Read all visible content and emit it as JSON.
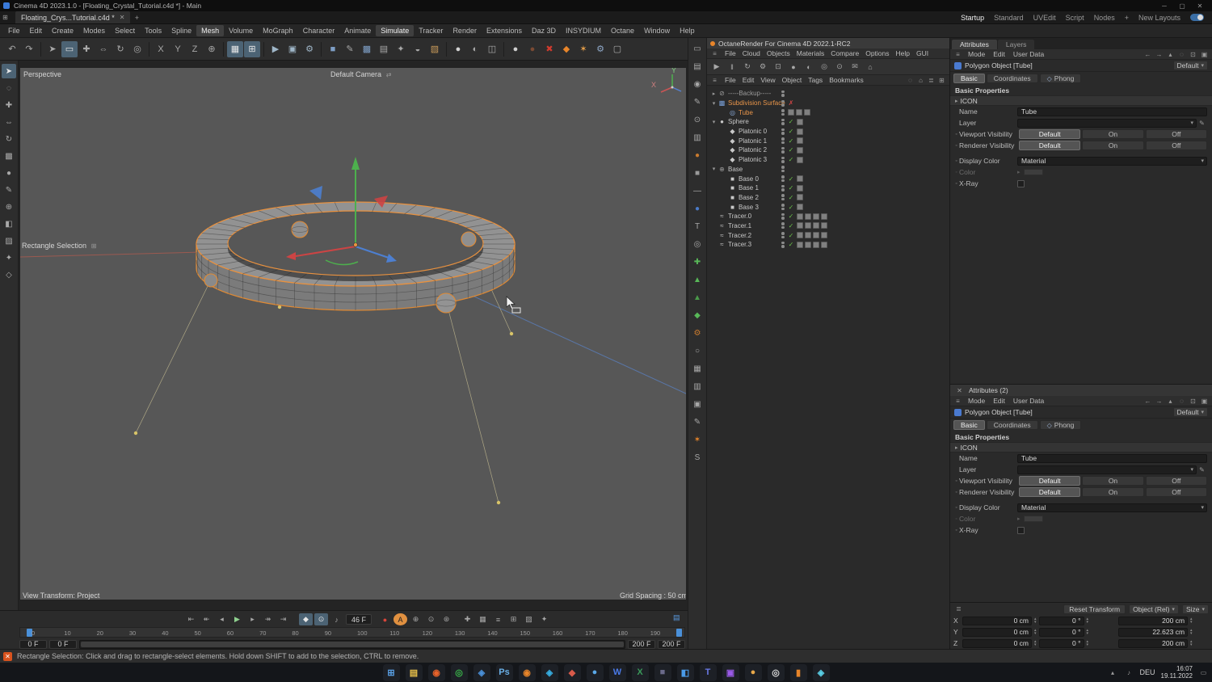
{
  "window": {
    "title": "Cinema 4D 2023.1.0 - [Floating_Crystal_Tutorial.c4d *] - Main",
    "min": "─",
    "max": "▢",
    "close": "✕"
  },
  "tabbar": {
    "doc_tab": "Floating_Crys...Tutorial.c4d *",
    "close_glyph": "✕",
    "add_glyph": "+",
    "layouts": [
      "Startup",
      "Standard",
      "UVEdit",
      "Script",
      "Nodes"
    ],
    "active_layout_index": 0,
    "add_layout_glyph": "+",
    "new_layouts_label": "New Layouts"
  },
  "menubar": {
    "items": [
      "File",
      "Edit",
      "Create",
      "Modes",
      "Select",
      "Tools",
      "Spline",
      "Mesh",
      "Volume",
      "MoGraph",
      "Character",
      "Animate",
      "Simulate",
      "Tracker",
      "Render",
      "Extensions",
      "Daz 3D",
      "INSYDIUM",
      "Octane",
      "Window",
      "Help"
    ],
    "highlighted": [
      "Mesh",
      "Simulate"
    ]
  },
  "viewport": {
    "view_label": "Perspective",
    "camera_label": "Default Camera",
    "selection_tool_label": "Rectangle Selection",
    "transform_label": "View Transform: Project",
    "grid_label": "Grid Spacing : 50 cm",
    "axis_labels": {
      "x": "X",
      "y": "Y"
    }
  },
  "timeline": {
    "frame_field": "46 F",
    "ticks": [
      "0",
      "10",
      "20",
      "30",
      "40",
      "50",
      "60",
      "70",
      "80",
      "90",
      "100",
      "110",
      "120",
      "130",
      "140",
      "150",
      "160",
      "170",
      "180",
      "190"
    ],
    "range_fields": [
      "0 F",
      "0 F",
      "200 F",
      "200 F"
    ]
  },
  "status_bar": {
    "text": "Rectangle Selection: Click and drag to rectangle-select elements. Hold down SHIFT to add to the selection, CTRL to remove."
  },
  "octane": {
    "title": "OctaneRender For Cinema 4D 2022.1-RC2",
    "menus": [
      "File",
      "Cloud",
      "Objects",
      "Materials",
      "Compare",
      "Options",
      "Help",
      "GUI"
    ]
  },
  "object_manager": {
    "menus": [
      "File",
      "Edit",
      "View",
      "Object",
      "Tags",
      "Bookmarks"
    ],
    "items": [
      {
        "label": "-----Backup-----",
        "indent": 0,
        "arrow": "closed",
        "icon_g": "⊘",
        "icon_c": "#9a9a9a",
        "label_c": "#9a9a9a",
        "dots": true,
        "mark": null,
        "tags": 0,
        "selected": false
      },
      {
        "label": "Subdivision Surface",
        "indent": 0,
        "arrow": "open",
        "icon_g": "▩",
        "icon_c": "#7aa0d8",
        "dots": true,
        "mark": "x",
        "tags": 0,
        "selected": true
      },
      {
        "label": "Tube",
        "indent": 1,
        "arrow": null,
        "icon_g": "◎",
        "icon_c": "#8fb0e0",
        "dots": true,
        "mark": null,
        "tags": 3,
        "selected": true
      },
      {
        "label": "Sphere",
        "indent": 0,
        "arrow": "open",
        "icon_g": "●",
        "icon_c": "#c8c8c8",
        "dots": true,
        "mark": "check",
        "tags": 1,
        "selected": false
      },
      {
        "label": "Platonic 0",
        "indent": 1,
        "arrow": null,
        "icon_g": "◆",
        "icon_c": "#c8c8c8",
        "dots": true,
        "mark": "check",
        "tags": 1,
        "selected": false
      },
      {
        "label": "Platonic 1",
        "indent": 1,
        "arrow": null,
        "icon_g": "◆",
        "icon_c": "#c8c8c8",
        "dots": true,
        "mark": "check",
        "tags": 1,
        "selected": false
      },
      {
        "label": "Platonic 2",
        "indent": 1,
        "arrow": null,
        "icon_g": "◆",
        "icon_c": "#c8c8c8",
        "dots": true,
        "mark": "check",
        "tags": 1,
        "selected": false
      },
      {
        "label": "Platonic 3",
        "indent": 1,
        "arrow": null,
        "icon_g": "◆",
        "icon_c": "#c8c8c8",
        "dots": true,
        "mark": "check",
        "tags": 1,
        "selected": false
      },
      {
        "label": "Base",
        "indent": 0,
        "arrow": "open",
        "icon_g": "⊕",
        "icon_c": "#9a9a9a",
        "dots": true,
        "mark": null,
        "tags": 0,
        "selected": false
      },
      {
        "label": "Base 0",
        "indent": 1,
        "arrow": null,
        "icon_g": "■",
        "icon_c": "#c8c8c8",
        "dots": true,
        "mark": "check",
        "tags": 1,
        "selected": false
      },
      {
        "label": "Base 1",
        "indent": 1,
        "arrow": null,
        "icon_g": "■",
        "icon_c": "#c8c8c8",
        "dots": true,
        "mark": "check",
        "tags": 1,
        "selected": false
      },
      {
        "label": "Base 2",
        "indent": 1,
        "arrow": null,
        "icon_g": "■",
        "icon_c": "#c8c8c8",
        "dots": true,
        "mark": "check",
        "tags": 1,
        "selected": false
      },
      {
        "label": "Base 3",
        "indent": 1,
        "arrow": null,
        "icon_g": "■",
        "icon_c": "#c8c8c8",
        "dots": true,
        "mark": "check",
        "tags": 1,
        "selected": false
      },
      {
        "label": "Tracer.0",
        "indent": 0,
        "arrow": null,
        "icon_g": "≈",
        "icon_c": "#c8c8c8",
        "dots": true,
        "mark": "check",
        "tags": 4,
        "selected": false
      },
      {
        "label": "Tracer.1",
        "indent": 0,
        "arrow": null,
        "icon_g": "≈",
        "icon_c": "#c8c8c8",
        "dots": true,
        "mark": "check",
        "tags": 4,
        "selected": false
      },
      {
        "label": "Tracer.2",
        "indent": 0,
        "arrow": null,
        "icon_g": "≈",
        "icon_c": "#c8c8c8",
        "dots": true,
        "mark": "check",
        "tags": 4,
        "selected": false
      },
      {
        "label": "Tracer.3",
        "indent": 0,
        "arrow": null,
        "icon_g": "≈",
        "icon_c": "#c8c8c8",
        "dots": true,
        "mark": "check",
        "tags": 4,
        "selected": false
      }
    ]
  },
  "attr_panels": {
    "panel1_tab_attributes": "Attributes",
    "panel1_tab_layers": "Layers",
    "panel2_title": "Attributes (2)",
    "panel2_close_glyph": "✕"
  },
  "attr": {
    "menus": [
      "Mode",
      "Edit",
      "User Data"
    ],
    "object_title": "Polygon Object [Tube]",
    "preset": "Default",
    "tabs": [
      "Basic",
      "Coordinates",
      "Phong"
    ],
    "section": "Basic Properties",
    "icon_group": "ICON",
    "name_label": "Name",
    "name_value": "Tube",
    "layer_label": "Layer",
    "viewport_visibility_label": "Viewport Visibility",
    "renderer_visibility_label": "Renderer Visibility",
    "visibility_options": [
      "Default",
      "On",
      "Off"
    ],
    "display_color_label": "Display Color",
    "display_color_value": "Material",
    "color_label": "Color",
    "xray_label": "X-Ray"
  },
  "coordinates": {
    "reset_label": "Reset Transform",
    "mode_label": "Object (Rel)",
    "size_label": "Size",
    "rows": [
      {
        "axis": "X",
        "pos": "0 cm",
        "rot": "0 °",
        "size": "200 cm"
      },
      {
        "axis": "Y",
        "pos": "0 cm",
        "rot": "0 °",
        "size": "22.623 cm"
      },
      {
        "axis": "Z",
        "pos": "0 cm",
        "rot": "0 °",
        "size": "200 cm"
      }
    ]
  },
  "taskbar": {
    "time": "16:07",
    "date": "19.11.2022",
    "lang": "DEU",
    "apps": [
      {
        "n": "start-button",
        "g": "⊞",
        "c": "#5aa2e8"
      },
      {
        "n": "taskbar-explorer",
        "g": "▤",
        "c": "#e8c04a"
      },
      {
        "n": "taskbar-firefox",
        "g": "◉",
        "c": "#e8622a"
      },
      {
        "n": "taskbar-spotify",
        "g": "◎",
        "c": "#3ab54a"
      },
      {
        "n": "taskbar-safari",
        "g": "◈",
        "c": "#4a90d9"
      },
      {
        "n": "taskbar-photoshop",
        "g": "Ps",
        "c": "#6ab0e8"
      },
      {
        "n": "taskbar-firefox-dev",
        "g": "◉",
        "c": "#e8852a"
      },
      {
        "n": "taskbar-telegram",
        "g": "◈",
        "c": "#37aee2"
      },
      {
        "n": "taskbar-app-red",
        "g": "◆",
        "c": "#d85a4a"
      },
      {
        "n": "taskbar-app-blue",
        "g": "●",
        "c": "#5aa8e8"
      },
      {
        "n": "taskbar-word",
        "g": "W",
        "c": "#4a7ae8"
      },
      {
        "n": "taskbar-excel",
        "g": "X",
        "c": "#3a9a5a"
      },
      {
        "n": "taskbar-app-dark",
        "g": "■",
        "c": "#6a6a8a"
      },
      {
        "n": "taskbar-vscode",
        "g": "◧",
        "c": "#4a9ae8"
      },
      {
        "n": "taskbar-teams",
        "g": "T",
        "c": "#6a7ae8"
      },
      {
        "n": "taskbar-app-purple",
        "g": "▣",
        "c": "#9a5ae8"
      },
      {
        "n": "taskbar-app-orange",
        "g": "●",
        "c": "#e8a84a"
      },
      {
        "n": "taskbar-app-white",
        "g": "◎",
        "c": "#d8d8d8"
      },
      {
        "n": "taskbar-folder",
        "g": "▮",
        "c": "#e8852a"
      },
      {
        "n": "taskbar-chat",
        "g": "◈",
        "c": "#5ad0e8"
      }
    ]
  },
  "ui_icons": {
    "toolbar": [
      {
        "n": "undo-icon",
        "g": "↶"
      },
      {
        "n": "redo-icon",
        "g": "↷"
      },
      {
        "sep": true
      },
      {
        "n": "live-selection-icon",
        "g": "➤"
      },
      {
        "n": "rectangle-selection-icon",
        "g": "▭",
        "a": true
      },
      {
        "n": "move-tool-icon",
        "g": "✚"
      },
      {
        "n": "scale-tool-icon",
        "g": "⇔"
      },
      {
        "n": "rotate-tool-icon",
        "g": "↻"
      },
      {
        "n": "last-tool-icon",
        "g": "◎"
      },
      {
        "sep": true
      },
      {
        "n": "axis-lock-x-icon",
        "g": "X"
      },
      {
        "n": "axis-lock-y-icon",
        "g": "Y"
      },
      {
        "n": "axis-lock-z-icon",
        "g": "Z"
      },
      {
        "n": "coordinate-system-icon",
        "g": "⊕"
      },
      {
        "sep": true
      },
      {
        "n": "snap-icon",
        "g": "▦",
        "a": true
      },
      {
        "n": "quantize-icon",
        "g": "⊞",
        "a": true
      },
      {
        "sep": true
      },
      {
        "n": "render-view-icon",
        "g": "▶",
        "c": "#9fb6c8"
      },
      {
        "n": "render-picture-viewer-icon",
        "g": "▣",
        "c": "#9fb6c8"
      },
      {
        "n": "render-settings-icon",
        "g": "⚙",
        "c": "#9fb6c8"
      },
      {
        "sep": true
      },
      {
        "n": "primitive-cube-icon",
        "g": "■",
        "c": "#7e9fc6"
      },
      {
        "n": "spline-pen-icon",
        "g": "✎"
      },
      {
        "n": "generators-icon",
        "g": "▩",
        "c": "#7e9fc6"
      },
      {
        "n": "camera-icon",
        "g": "▤"
      },
      {
        "n": "mograph-icon",
        "g": "✦"
      },
      {
        "n": "fields-icon",
        "g": "◒"
      },
      {
        "n": "deformer-icon",
        "g": "▧",
        "c": "#c89a5a"
      },
      {
        "sep": true
      },
      {
        "n": "display-shaded-icon",
        "g": "●",
        "c": "#d2d2d2"
      },
      {
        "n": "display-wire-icon",
        "g": "◐"
      },
      {
        "n": "split-view-icon",
        "g": "◫"
      },
      {
        "sep": true
      },
      {
        "n": "material-ball-icon",
        "g": "●",
        "c": "#cfcfcf"
      },
      {
        "n": "material-dark-icon",
        "g": "●",
        "c": "#7a4a33"
      },
      {
        "n": "xparticles-icon",
        "g": "✖",
        "c": "#d23b2e"
      },
      {
        "n": "octane-icon",
        "g": "◆",
        "c": "#e8852a"
      },
      {
        "n": "insydium-icon",
        "g": "✶",
        "c": "#e8a04a"
      },
      {
        "n": "settings-icon",
        "g": "⚙",
        "c": "#8fa8c8"
      },
      {
        "n": "layout-icon",
        "g": "▢"
      }
    ],
    "left_tools": [
      {
        "n": "select-arrow-icon",
        "g": "➤",
        "a": true
      },
      {
        "n": "lasso-icon",
        "g": "◌"
      },
      {
        "n": "move-icon",
        "g": "✚"
      },
      {
        "n": "scale-icon",
        "g": "⇔"
      },
      {
        "n": "rotate-icon",
        "g": "↻"
      },
      {
        "n": "extrude-icon",
        "g": "▩"
      },
      {
        "n": "sphere-icon",
        "g": "●"
      },
      {
        "n": "pen-icon",
        "g": "✎"
      },
      {
        "n": "axis-icon",
        "g": "⊕"
      },
      {
        "n": "symmetry-icon",
        "g": "◧"
      },
      {
        "n": "paint-icon",
        "g": "▨"
      },
      {
        "n": "magic-icon",
        "g": "✦"
      },
      {
        "n": "misc-icon",
        "g": "◇"
      }
    ],
    "right_tools": [
      {
        "n": "area-render-icon",
        "g": "▭"
      },
      {
        "n": "picture-viewer-icon",
        "g": "▤"
      },
      {
        "n": "target-icon",
        "g": "◉"
      },
      {
        "n": "pen2-icon",
        "g": "✎"
      },
      {
        "n": "focus-icon",
        "g": "⊙"
      },
      {
        "n": "film-icon",
        "g": "▥"
      },
      {
        "n": "material-orange-icon",
        "g": "●",
        "c": "#c87a2e"
      },
      {
        "n": "cube-gray-icon",
        "g": "■",
        "c": "#9a9a9a"
      },
      {
        "n": "divider-icon",
        "g": "—"
      },
      {
        "n": "sphere-blue-icon",
        "g": "●",
        "c": "#4a7ac8"
      },
      {
        "n": "text-tool-icon",
        "g": "T"
      },
      {
        "n": "ring-icon",
        "g": "◎"
      },
      {
        "n": "axis-green-icon",
        "g": "✚",
        "c": "#58b858"
      },
      {
        "n": "cone-green-icon",
        "g": "▲",
        "c": "#58b858"
      },
      {
        "n": "tree-green-icon",
        "g": "▲",
        "c": "#4a9a4a"
      },
      {
        "n": "poly-green-icon",
        "g": "◆",
        "c": "#58b858"
      },
      {
        "n": "gear-orange-icon",
        "g": "⚙",
        "c": "#c87a2e"
      },
      {
        "n": "sphere-small-icon",
        "g": "○"
      },
      {
        "n": "grid-icon",
        "g": "▦"
      },
      {
        "n": "chart-icon",
        "g": "▥"
      },
      {
        "n": "camera2-icon",
        "g": "▣"
      },
      {
        "n": "paint2-icon",
        "g": "✎"
      },
      {
        "n": "star-orange-icon",
        "g": "✶",
        "c": "#e8852a"
      },
      {
        "n": "spline-icon",
        "g": "S"
      }
    ],
    "octane_icons": [
      {
        "n": "render-start-icon",
        "g": "▶"
      },
      {
        "n": "render-pause-icon",
        "g": "‖"
      },
      {
        "n": "render-restart-icon",
        "g": "↻"
      },
      {
        "n": "render-settings-icon",
        "g": "⚙"
      },
      {
        "n": "lock-resolution-icon",
        "g": "⊡"
      },
      {
        "n": "material-ball-icon",
        "g": "●"
      },
      {
        "n": "material-half-icon",
        "g": "◐"
      },
      {
        "n": "material-ring-icon",
        "g": "◎"
      },
      {
        "n": "camera-target-icon",
        "g": "⊙"
      },
      {
        "n": "send-icon",
        "g": "✉"
      },
      {
        "n": "home-icon",
        "g": "⌂"
      }
    ],
    "om_window_icons": [
      {
        "n": "om-search-icon",
        "g": "◌"
      },
      {
        "n": "om-home-icon",
        "g": "⌂"
      },
      {
        "n": "om-filter-icon",
        "g": "≣"
      },
      {
        "n": "om-layout-icon",
        "g": "⊞"
      }
    ],
    "attr_nav": [
      {
        "n": "nav-back-icon",
        "g": "←"
      },
      {
        "n": "nav-forward-icon",
        "g": "→"
      },
      {
        "n": "nav-up-icon",
        "g": "▴"
      },
      {
        "n": "search-icon",
        "g": "◌"
      },
      {
        "n": "lock-icon",
        "g": "⊡"
      },
      {
        "n": "new-window-icon",
        "g": "▣"
      }
    ],
    "transport": [
      {
        "n": "goto-start-icon",
        "g": "⇤"
      },
      {
        "n": "prev-key-icon",
        "g": "↞"
      },
      {
        "n": "prev-frame-icon",
        "g": "◂"
      },
      {
        "n": "play-icon",
        "g": "▶",
        "c": "#8fd08f"
      },
      {
        "n": "next-frame-icon",
        "g": "▸"
      },
      {
        "n": "next-key-icon",
        "g": "↠"
      },
      {
        "n": "goto-end-icon",
        "g": "⇥"
      }
    ],
    "keyframe_toggles": [
      {
        "n": "key-position-icon",
        "g": "◆",
        "a": true
      },
      {
        "n": "key-interpolation-icon",
        "g": "⊙",
        "a": true
      },
      {
        "n": "sound-icon",
        "g": "♪"
      }
    ],
    "record": [
      {
        "n": "record-key-icon",
        "g": "●",
        "c": "#d8453a"
      },
      {
        "n": "autokey-icon",
        "g": "A",
        "bg": "#e09040",
        "c": "#1e1e1e"
      },
      {
        "n": "record-position-icon",
        "g": "⊕"
      },
      {
        "n": "record-scale-icon",
        "g": "⊙"
      },
      {
        "n": "record-rotation-icon",
        "g": "⊛"
      }
    ],
    "timeline_extra": [
      {
        "n": "snap-key-icon",
        "g": "✚"
      },
      {
        "n": "grid-key-icon",
        "g": "▦"
      },
      {
        "n": "track-icon",
        "g": "≡"
      },
      {
        "n": "marker-icon",
        "g": "⊞"
      },
      {
        "n": "ramp-icon",
        "g": "▨"
      },
      {
        "n": "motion-icon",
        "g": "✦"
      }
    ]
  }
}
